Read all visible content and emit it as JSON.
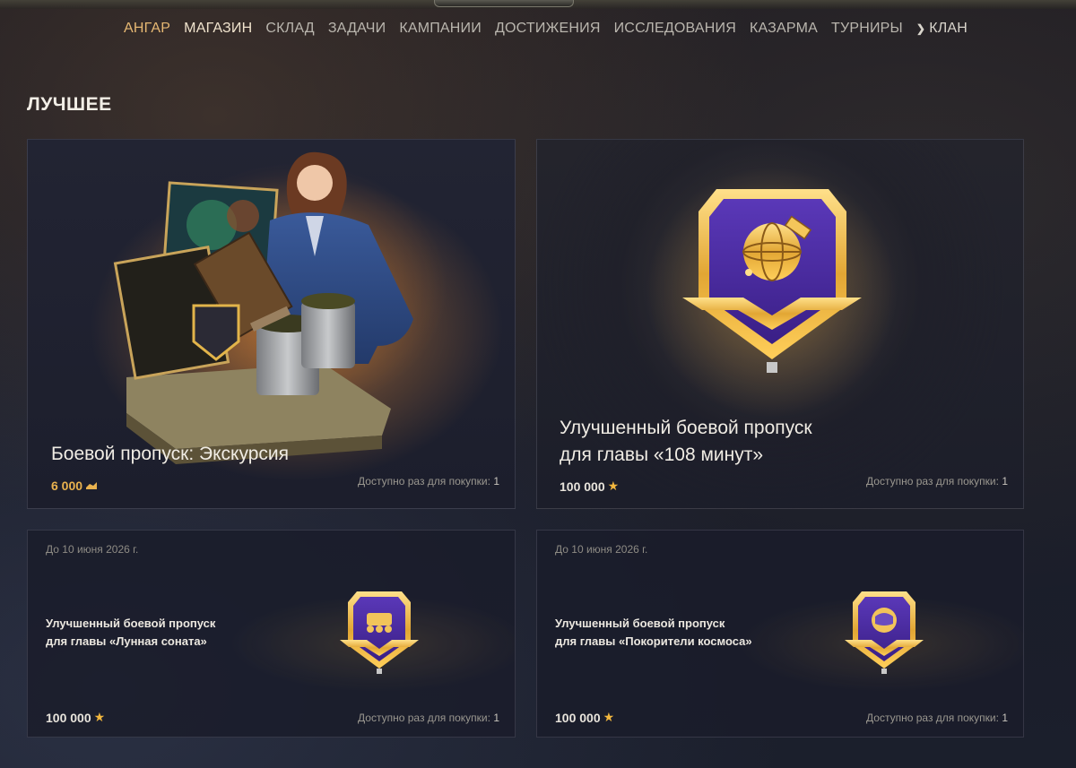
{
  "nav": {
    "items": [
      "АНГАР",
      "МАГАЗИН",
      "СКЛАД",
      "ЗАДАЧИ",
      "КАМПАНИИ",
      "ДОСТИЖЕНИЯ",
      "ИССЛЕДОВАНИЯ",
      "КАЗАРМА",
      "ТУРНИРЫ"
    ],
    "clan": "КЛАН"
  },
  "section_title": "ЛУЧШЕЕ",
  "cards": [
    {
      "title": "Боевой пропуск: Экскурсия",
      "price": "6 000",
      "currency": "gold-icon",
      "availability_label": "Доступно раз для покупки:",
      "availability_count": "1"
    },
    {
      "title_line1": "Улучшенный боевой пропуск",
      "title_line2": "для главы «108 минут»",
      "price": "100 000",
      "currency": "star-icon",
      "availability_label": "Доступно раз для покупки:",
      "availability_count": "1"
    },
    {
      "date": "До 10 июня 2026 г.",
      "title": "Улучшенный боевой пропуск\nдля главы «Лунная соната»",
      "price": "100 000",
      "currency": "star-icon",
      "availability_label": "Доступно раз для покупки:",
      "availability_count": "1"
    },
    {
      "date": "До 10 июня 2026 г.",
      "title": "Улучшенный боевой пропуск\nдля главы «Покорители космоса»",
      "price": "100 000",
      "currency": "star-icon",
      "availability_label": "Доступно раз для покупки:",
      "availability_count": "1"
    }
  ],
  "colors": {
    "accent_gold": "#e9b24e",
    "star": "#f2b73e",
    "badge_purple": "#4a2a9c"
  }
}
